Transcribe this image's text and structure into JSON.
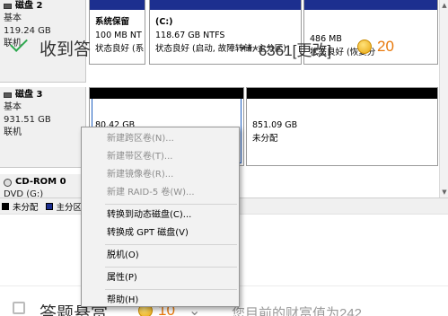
{
  "disks": [
    {
      "name": "磁盘 2",
      "type": "基本",
      "size": "119.24 GB",
      "status": "联机",
      "partitions": [
        {
          "title": "系统保留",
          "size": "100 MB NT",
          "status": "状态良好 (系"
        },
        {
          "title": "(C:)",
          "size": "118.67 GB NTFS",
          "status": "状态良好 (启动, 故障转储, 主分区)"
        },
        {
          "title": "",
          "size": "486 MB",
          "status": "状态良好 (恢复分"
        }
      ]
    },
    {
      "name": "磁盘 3",
      "type": "基本",
      "size": "931.51 GB",
      "status": "联机",
      "partitions": [
        {
          "size": "80.42 GB",
          "status": ""
        },
        {
          "size": "851.09 GB",
          "status": "未分配"
        }
      ]
    }
  ],
  "cdrom": {
    "name": "CD-ROM 0",
    "sub": "DVD (G:)"
  },
  "legend": [
    {
      "label": "未分配",
      "color": "#000000"
    },
    {
      "label": "主分区",
      "color": "#1c2f8f"
    }
  ],
  "context_menu": [
    {
      "label": "新建跨区卷(N)...",
      "enabled": false
    },
    {
      "label": "新建带区卷(T)...",
      "enabled": false
    },
    {
      "label": "新建镜像卷(R)...",
      "enabled": false
    },
    {
      "label": "新建 RAID-5 卷(W)...",
      "enabled": false
    },
    {
      "label": "转换到动态磁盘(C)...",
      "enabled": true
    },
    {
      "label": "转换成 GPT 磁盘(V)",
      "enabled": true
    },
    {
      "label": "脱机(O)",
      "enabled": true
    },
    {
      "label": "属性(P)",
      "enabled": true
    },
    {
      "label": "帮助(H)",
      "enabled": true
    }
  ],
  "web": {
    "received": "收到答",
    "phone": "***6361[更改]",
    "reward_received": "20",
    "answer": "答题悬赏",
    "reward_answer": "10",
    "wealth": "您目前的财富值为242"
  },
  "colors": {
    "primary_bar": "#1c2f8f",
    "unallocated_bar": "#000000",
    "accent_orange": "#e8790c",
    "check_green": "#2ea84f"
  }
}
